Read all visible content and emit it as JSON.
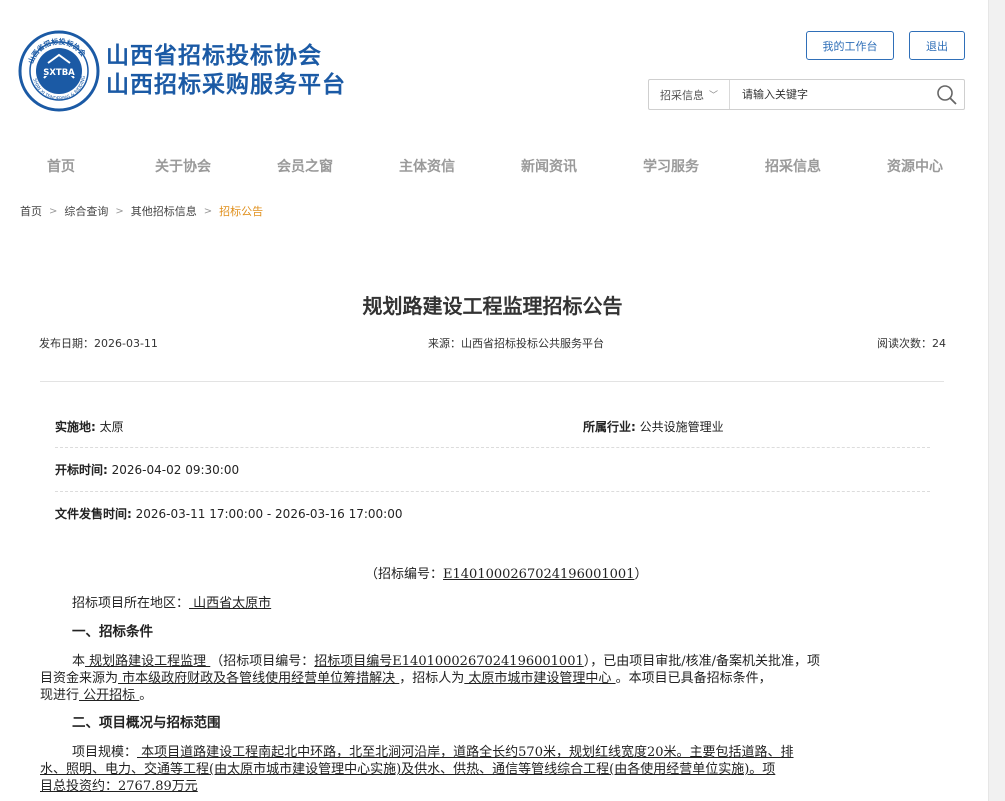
{
  "header": {
    "logo_circle_text": "SXTBA",
    "logo_ring_top": "山西省招标投标协会",
    "logo_ring_bottom": "SHAN XI TENDERING & BIDDING",
    "org_name_line1": "山西省招标投标协会",
    "org_name_line2": "山西招标采购服务平台",
    "workbench_label": "我的工作台",
    "logout_label": "退出",
    "brand_color": "#1b5aa5"
  },
  "search": {
    "category": "招采信息",
    "placeholder": "请输入关键字"
  },
  "nav": {
    "items": [
      "首页",
      "关于协会",
      "会员之窗",
      "主体资信",
      "新闻资讯",
      "学习服务",
      "招采信息",
      "资源中心"
    ]
  },
  "breadcrumb": {
    "items": [
      "首页",
      "综合查询",
      "其他招标信息"
    ],
    "current": "招标公告"
  },
  "article": {
    "title": "规划路建设工程监理招标公告",
    "publish_date_label": "发布日期：",
    "publish_date": "2026-03-11",
    "source_label": "来源：",
    "source": "山西省招标投标公共服务平台",
    "views_label": "阅读次数：",
    "views": "24"
  },
  "info": {
    "location_label": "实施地:",
    "location": "太原",
    "industry_label": "所属行业:",
    "industry": "公共设施管理业",
    "open_time_label": "开标时间:",
    "open_time": "2026-04-02 09:30:00",
    "doc_time_label": "文件发售时间:",
    "doc_time": "2026-03-11 17:00:00 - 2026-03-16 17:00:00"
  },
  "doc": {
    "bid_no_prefix": "（招标编号：",
    "bid_no": "E1401000267024196001001",
    "bid_no_suffix": "）",
    "region_label": "招标项目所在地区：",
    "region": " 山西省太原市 ",
    "sec1_title": "一、招标条件",
    "p1_a": "本",
    "p1_b": " 规划路建设工程监理 ",
    "p1_c": "（招标项目编号：",
    "p1_d": "招标项目编号E1401000267024196001001",
    "p1_e": "），已由项目审批/核准/备案机关批准，项",
    "p1_f": "目资金来源为",
    "p1_g": " 市本级政府财政及各管线使用经营单位筹措解决 ",
    "p1_h": "，招标人为",
    "p1_i": " 太原市城市建设管理中心 ",
    "p1_j": "。本项目已具备招标条件，",
    "p1_k": "现进行",
    "p1_l": " 公开招标 ",
    "p1_m": "。",
    "sec2_title": "二、项目概况与招标范围",
    "p2_a": "项目规模：",
    "p2_b": " 本项目道路建设工程南起北中环路，北至北涧河沿岸，道路全长约570米，规划红线宽度20米。主要包括道路、排",
    "p2_c": "水、照明、电力、交通等工程(由太原市城市建设管理中心实施)及供水、供热、通信等管线综合工程(由各使用经营单位实施)。项",
    "p2_d": "目总投资约：2767.89万元 "
  }
}
